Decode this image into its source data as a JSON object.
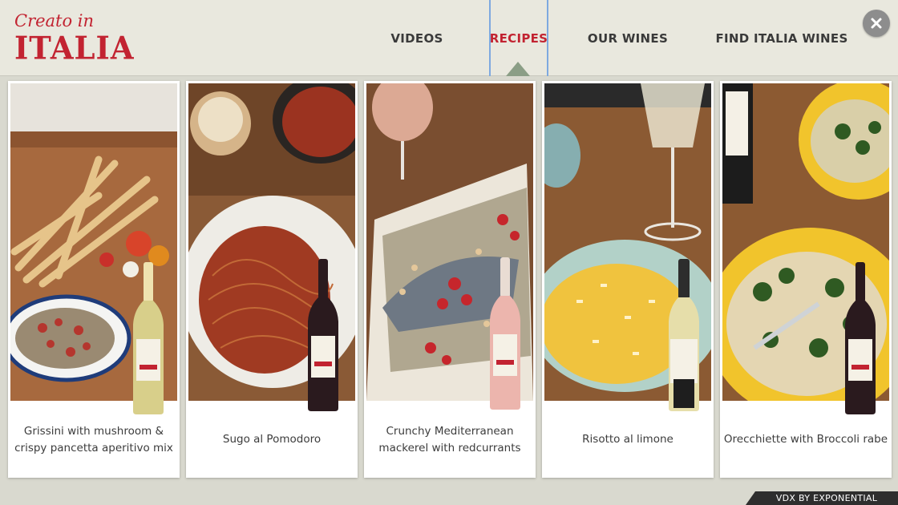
{
  "brand": {
    "script": "Creato in",
    "main": "ITALIA"
  },
  "nav": {
    "items": [
      {
        "label": "VIDEOS"
      },
      {
        "label": "RECIPES",
        "active": true
      },
      {
        "label": "OUR WINES"
      },
      {
        "label": "FIND ITALIA WINES"
      }
    ]
  },
  "close_icon": "close-icon",
  "cards": [
    {
      "title": "Grissini with mushroom & crispy pancetta aperitivo mix",
      "wine": "white"
    },
    {
      "title": "Sugo al Pomodoro",
      "wine": "red"
    },
    {
      "title": "Crunchy Mediterranean mackerel with redcurrants",
      "wine": "rosé"
    },
    {
      "title": "Risotto al limone",
      "wine": "sparkling"
    },
    {
      "title": "Orecchiette with Broccoli rabe",
      "wine": "red"
    }
  ],
  "footer": {
    "label": "VDX BY EXPONENTIAL"
  },
  "colors": {
    "brand_red": "#c22331",
    "header_bg": "#e9e8de",
    "page_bg": "#d9d9cf",
    "active_border": "#7ea9e0"
  }
}
